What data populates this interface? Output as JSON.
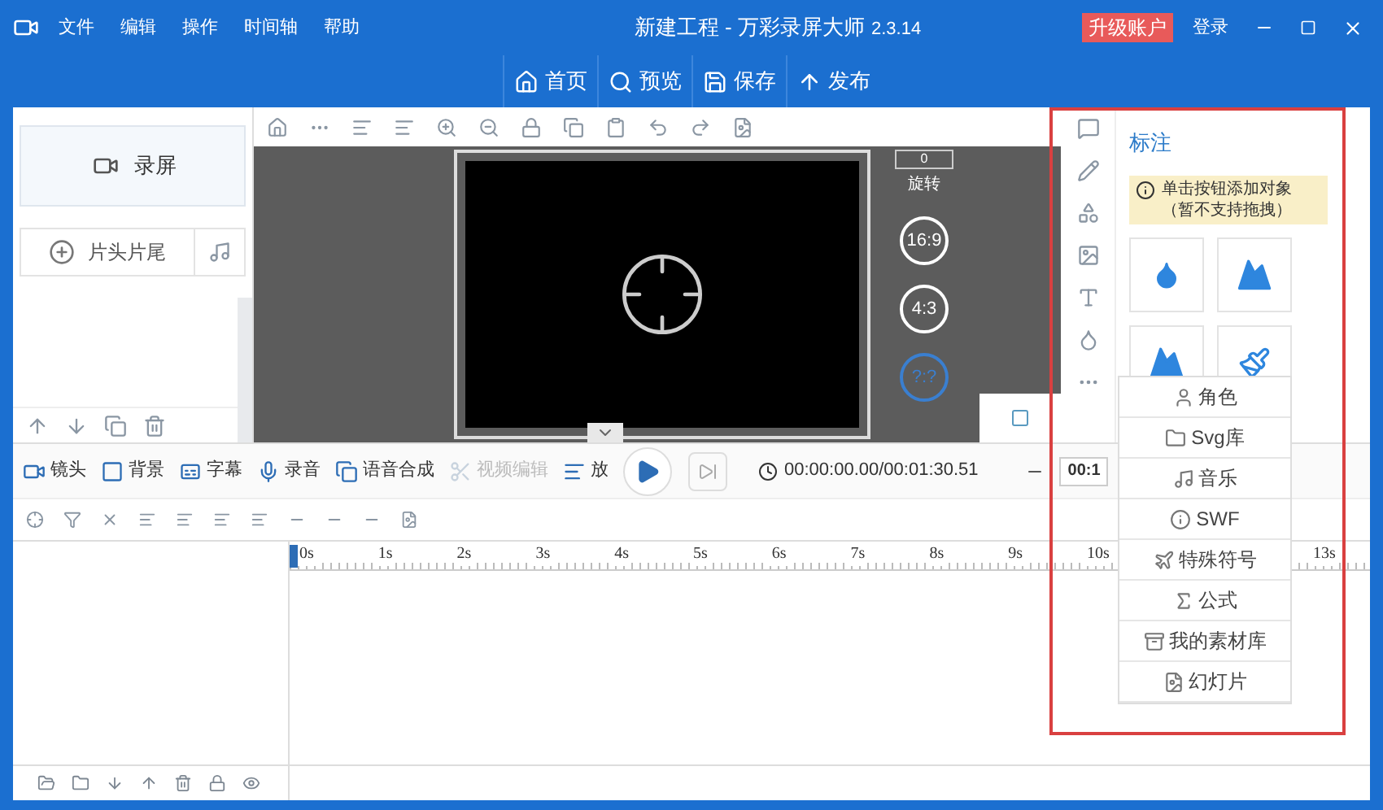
{
  "window": {
    "title": "新建工程 - 万彩录屏大师",
    "version": "2.3.14",
    "upgrade": "升级账户",
    "login": "登录"
  },
  "menu": [
    "文件",
    "编辑",
    "操作",
    "时间轴",
    "帮助"
  ],
  "nav": [
    {
      "label": "首页",
      "kind": "home"
    },
    {
      "label": "预览",
      "kind": "preview"
    },
    {
      "label": "保存",
      "kind": "save"
    },
    {
      "label": "发布",
      "kind": "publish"
    }
  ],
  "left_panel": {
    "record_button": "录屏",
    "intro_button": "片头片尾"
  },
  "canvas": {
    "rotation": "0",
    "rotation_label": "旋转",
    "ratios": [
      {
        "label": "16:9",
        "selected": false
      },
      {
        "label": "4:3",
        "selected": false
      },
      {
        "label": "?:?",
        "selected": true
      }
    ]
  },
  "side_panel": {
    "title": "标注",
    "notice": "单击按钮添加对象（暂不支持拖拽）"
  },
  "popup_menu": [
    {
      "label": "角色",
      "kind": "role"
    },
    {
      "label": "Svg库",
      "kind": "folder"
    },
    {
      "label": "音乐",
      "kind": "music"
    },
    {
      "label": "SWF",
      "kind": "swf"
    },
    {
      "label": "特殊符号",
      "kind": "symbol"
    },
    {
      "label": "公式",
      "kind": "formula"
    },
    {
      "label": "我的素材库",
      "kind": "library"
    },
    {
      "label": "幻灯片",
      "kind": "slide"
    }
  ],
  "toolbar": [
    {
      "label": "镜头",
      "kind": "camera",
      "disabled": false
    },
    {
      "label": "背景",
      "kind": "background",
      "disabled": false
    },
    {
      "label": "字幕",
      "kind": "subtitle",
      "disabled": false
    },
    {
      "label": "录音",
      "kind": "mic",
      "disabled": false
    },
    {
      "label": "语音合成",
      "kind": "tts",
      "disabled": false
    },
    {
      "label": "视频编辑",
      "kind": "edit",
      "disabled": true
    },
    {
      "label": "放",
      "kind": "zoom",
      "disabled": false
    }
  ],
  "time": "00:00:00.00/00:01:30.51",
  "zoom_field": "00:1",
  "ruler": [
    "0s",
    "1s",
    "2s",
    "3s",
    "4s",
    "5s",
    "6s",
    "7s",
    "8s",
    "9s",
    "10s",
    "13s"
  ]
}
